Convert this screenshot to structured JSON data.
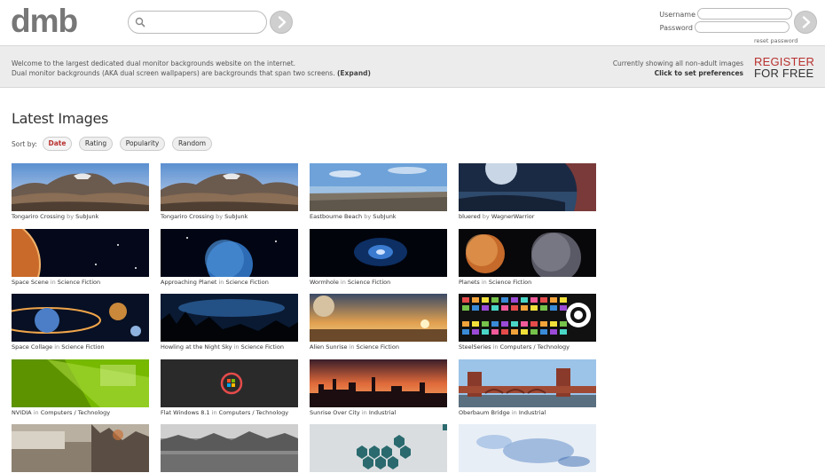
{
  "header": {
    "logo": "dmb",
    "search": {
      "value": "",
      "placeholder": ""
    },
    "login": {
      "username_label": "Username",
      "password_label": "Password",
      "reset_password": "reset password"
    }
  },
  "band": {
    "welcome_line1": "Welcome to the largest dedicated dual monitor backgrounds website on the internet.",
    "welcome_line2": "Dual monitor backgrounds (AKA dual screen wallpapers) are backgrounds that span two screens.",
    "expand": "(Expand)",
    "showing": "Currently showing all non-adult images",
    "set_prefs": "Click to set preferences",
    "register_line1": "REGISTER",
    "register_line2": "FOR FREE"
  },
  "main": {
    "title": "Latest Images",
    "sort_label": "Sort by:",
    "sort_options": [
      "Date",
      "Rating",
      "Popularity",
      "Random"
    ]
  },
  "images": [
    {
      "title": "Tongariro Crossing",
      "sep": "by",
      "meta": "SubJunk",
      "thumb": "mountain"
    },
    {
      "title": "Tongariro Crossing",
      "sep": "by",
      "meta": "SubJunk",
      "thumb": "mountain"
    },
    {
      "title": "Eastbourne Beach",
      "sep": "by",
      "meta": "SubJunk",
      "thumb": "beach"
    },
    {
      "title": "bluered",
      "sep": "by",
      "meta": "WagnerWarrior",
      "thumb": "bluered"
    },
    {
      "title": "Space Scene",
      "sep": "in",
      "meta": "Science Fiction",
      "thumb": "space-scene"
    },
    {
      "title": "Approaching Planet",
      "sep": "in",
      "meta": "Science Fiction",
      "thumb": "planet-blue"
    },
    {
      "title": "Wormhole",
      "sep": "in",
      "meta": "Science Fiction",
      "thumb": "wormhole"
    },
    {
      "title": "Planets",
      "sep": "in",
      "meta": "Science Fiction",
      "thumb": "planets"
    },
    {
      "title": "Space Collage",
      "sep": "in",
      "meta": "Science Fiction",
      "thumb": "collage"
    },
    {
      "title": "Howling at the Night Sky",
      "sep": "in",
      "meta": "Science Fiction",
      "thumb": "night-sky"
    },
    {
      "title": "Alien Sunrise",
      "sep": "in",
      "meta": "Science Fiction",
      "thumb": "alien-sunrise"
    },
    {
      "title": "SteelSeries",
      "sep": "in",
      "meta": "Computers / Technology",
      "thumb": "steelseries"
    },
    {
      "title": "NVIDIA",
      "sep": "in",
      "meta": "Computers / Technology",
      "thumb": "nvidia"
    },
    {
      "title": "Flat Windows 8.1",
      "sep": "in",
      "meta": "Computers / Technology",
      "thumb": "windows"
    },
    {
      "title": "Sunrise Over City",
      "sep": "in",
      "meta": "Industrial",
      "thumb": "city-sunrise"
    },
    {
      "title": "Oberbaum Bridge",
      "sep": "in",
      "meta": "Industrial",
      "thumb": "bridge"
    },
    {
      "title": "",
      "sep": "",
      "meta": "",
      "thumb": "ruins"
    },
    {
      "title": "",
      "sep": "",
      "meta": "",
      "thumb": "old-city"
    },
    {
      "title": "",
      "sep": "",
      "meta": "",
      "thumb": "hexagons"
    },
    {
      "title": "",
      "sep": "",
      "meta": "",
      "thumb": "ice"
    }
  ],
  "colors": {
    "accent_red": "#b8312f",
    "band_bg": "#ececec",
    "button_grey": "#cfcfcf"
  }
}
